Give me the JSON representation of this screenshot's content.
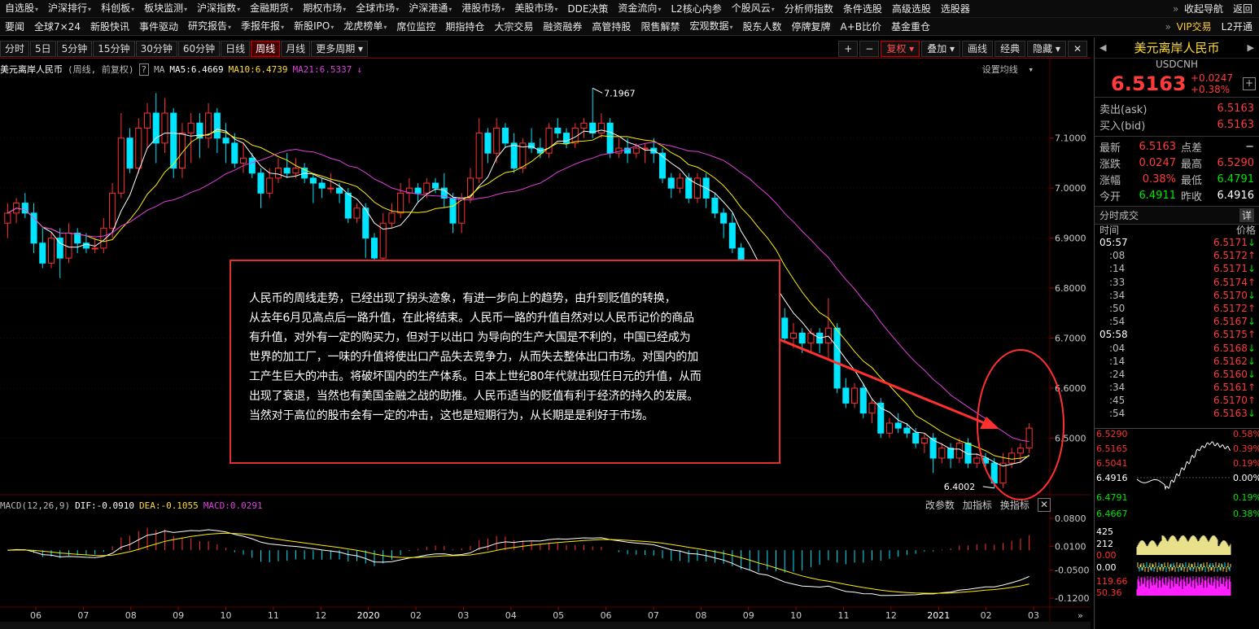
{
  "nav1": [
    "自选股",
    "沪深排行",
    "科创板",
    "板块监测",
    "沪深指数",
    "金融期货",
    "期权市场",
    "全球市场",
    "沪深港通",
    "港股市场",
    "美股市场",
    "DDE决策",
    "资金流向",
    "L2核心内参",
    "个股风云",
    "分析师指数",
    "条件选股",
    "高级选股",
    "选股器"
  ],
  "nav1_caret": [
    "▾",
    "▾",
    "▾",
    "▾",
    "▾",
    "▾",
    "▾",
    "▾",
    "▾",
    "▾",
    "▾",
    "",
    "▾",
    "",
    "▾",
    "",
    "",
    "",
    ""
  ],
  "nav1_right": [
    "收起导航",
    "返回"
  ],
  "nav2": [
    "要闻",
    "全球7×24",
    "新股快讯",
    "事件驱动",
    "研究报告",
    "季报年报",
    "新股IPO",
    "龙虎榜单",
    "席位监控",
    "期指持仓",
    "大宗交易",
    "融资融券",
    "高管持股",
    "限售解禁",
    "宏观数据",
    "股东人数",
    "停牌复牌",
    "A+B比价",
    "基金重仓"
  ],
  "nav2_caret": [
    "",
    "",
    "",
    "",
    "▾",
    "▾",
    "▾",
    "▾",
    "",
    "",
    "",
    "",
    "",
    "",
    "▾",
    "",
    "",
    "",
    ""
  ],
  "nav2_right": [
    "VIP交易",
    "L2开通"
  ],
  "periods": [
    "分时",
    "5日",
    "5分钟",
    "15分钟",
    "30分钟",
    "60分钟",
    "日线",
    "周线",
    "月线",
    "更多周期"
  ],
  "active_period": "周线",
  "toolbar_right": [
    "+",
    "−",
    "复权",
    "叠加",
    "画线",
    "经典",
    "隐藏"
  ],
  "legend": {
    "title": "美元离岸人民币",
    "mode": "(周线, 前复权)",
    "ma": "MA",
    "ma5": "MA5:6.4669",
    "ma10": "MA10:6.4739",
    "ma21": "MA21:6.5337",
    "settings": "设置均线"
  },
  "annotation": "人民币的周线走势，已经出现了拐头迹象，有进一步向上的趋势，由升到贬值的转换， 从去年6月见高点后一路升值，在此将结束。人民币一路的升值自然对以人民币记价的商品 有升值，对外有一定的购买力，但对于以出口 为导向的生产大国是不利的，中国已经成为世界的加工厂，一味的升值将使出口产品失去竞争力，从而失去整体出口市场。对国内的加工产生巨大的冲击。将破坏国内的生产体系。日本上世纪80年代就出现任日元的升值，从而出现了衰退，当然也有美国金融之战的助推。人民币适当的贬值有利于经济的持久的发展。当然对于高位的股市会有一定的冲击，这也是短期行为，从长期是是利好于市场。",
  "annotation_lines": [
    "人民币的周线走势，已经出现了拐头迹象，有进一步向上的趋势，由升到贬值的转换，",
    " 从去年6月见高点后一路升值，在此将结束。人民币一路的升值自然对以人民币记价的商品",
    " 有升值，对外有一定的购买力，但对于以出口 为导向的生产大国是不利的，中国已经成为",
    "世界的加工厂，一味的升值将使出口产品失去竞争力，从而失去整体出口市场。对国内的加",
    "工产生巨大的冲击。将破坏国内的生产体系。日本上世纪80年代就出现任日元的升值，从而",
    "出现了衰退，当然也有美国金融之战的助推。人民币适当的贬值有利于经济的持久的发展。",
    "当然对于高位的股市会有一定的冲击，这也是短期行为，从长期是是利好于市场。"
  ],
  "macd": {
    "name": "MACD(12,26,9)",
    "dif": "DIF:-0.0910",
    "dea": "DEA:-0.1055",
    "macd": "MACD:0.0291",
    "controls": [
      "改参数",
      "加指标",
      "换指标"
    ]
  },
  "side": {
    "name": "美元离岸人民币",
    "code": "USDCNH",
    "price": "6.5163",
    "chg": "+0.0247",
    "pct": "+0.38%",
    "ask_label": "卖出(ask)",
    "ask": "6.5163",
    "bid_label": "买入(bid)",
    "bid": "6.5163",
    "stats": [
      {
        "l1": "最新",
        "v1": "6.5163",
        "l2": "点差",
        "v2": "−"
      },
      {
        "l1": "涨跌",
        "v1": "0.0247",
        "l2": "最高",
        "v2": "6.5290"
      },
      {
        "l1": "涨幅",
        "v1": "0.38%",
        "l2": "最低",
        "v2": "6.4791"
      },
      {
        "l1": "今开",
        "v1": "6.4911",
        "l2": "昨收",
        "v2": "6.4916"
      }
    ],
    "ticks_title": "分时成交",
    "ticks_btn": "详",
    "ticks_h_time": "时间",
    "ticks_h_price": "价格",
    "ticks": [
      {
        "t": "05:57",
        "p": "6.5171",
        "d": "down"
      },
      {
        "t": ":08",
        "p": "6.5172",
        "d": "up"
      },
      {
        "t": ":14",
        "p": "6.5171",
        "d": "down"
      },
      {
        "t": ":33",
        "p": "6.5174",
        "d": "up"
      },
      {
        "t": ":34",
        "p": "6.5170",
        "d": "down"
      },
      {
        "t": ":50",
        "p": "6.5172",
        "d": "up"
      },
      {
        "t": ":54",
        "p": "6.5167",
        "d": "down"
      },
      {
        "t": "05:58",
        "p": "6.5175",
        "d": "up"
      },
      {
        "t": ":04",
        "p": "6.5168",
        "d": "down"
      },
      {
        "t": ":14",
        "p": "6.5162",
        "d": "down"
      },
      {
        "t": ":24",
        "p": "6.5160",
        "d": "down"
      },
      {
        "t": ":34",
        "p": "6.5161",
        "d": "up"
      },
      {
        "t": ":45",
        "p": "6.5170",
        "d": "up"
      },
      {
        "t": ":54",
        "p": "6.5163",
        "d": "down"
      }
    ],
    "mini_left": [
      "6.5290",
      "6.5165",
      "6.5041",
      "6.4916",
      "6.4791",
      "6.4667",
      "425",
      "212",
      "0.00",
      "0.00",
      "119.66",
      "50.36"
    ],
    "mini_right": [
      "0.58%",
      "0.39%",
      "0.19%",
      "0.00%",
      "0.19%",
      "0.38%"
    ]
  },
  "chart_data": {
    "type": "candlestick",
    "price_axis": [
      "7.1000",
      "7.0000",
      "6.9000",
      "6.8000",
      "6.7000",
      "6.6000",
      "6.5000"
    ],
    "time_axis": [
      "06",
      "07",
      "08",
      "09",
      "10",
      "11",
      "12",
      "2020",
      "02",
      "03",
      "04",
      "05",
      "06",
      "07",
      "08",
      "09",
      "10",
      "11",
      "12",
      "2021",
      "02",
      "03"
    ],
    "high_label": "7.1967",
    "low_label": "6.4002",
    "macd_axis": [
      "0.0800",
      "0.0100",
      "-0.0500",
      "-0.1200"
    ],
    "candles": [
      [
        6.93,
        6.95,
        6.9,
        6.97
      ],
      [
        6.95,
        6.97,
        6.93,
        6.98
      ],
      [
        6.97,
        6.95,
        6.94,
        6.99
      ],
      [
        6.95,
        6.89,
        6.87,
        6.97
      ],
      [
        6.89,
        6.85,
        6.84,
        6.92
      ],
      [
        6.85,
        6.9,
        6.84,
        6.91
      ],
      [
        6.9,
        6.86,
        6.82,
        6.92
      ],
      [
        6.86,
        6.91,
        6.85,
        6.93
      ],
      [
        6.91,
        6.89,
        6.87,
        6.92
      ],
      [
        6.89,
        6.88,
        6.87,
        6.91
      ],
      [
        6.88,
        6.88,
        6.87,
        6.9
      ],
      [
        6.88,
        6.92,
        6.87,
        6.94
      ],
      [
        6.92,
        6.99,
        6.9,
        7.01
      ],
      [
        6.99,
        7.1,
        6.98,
        7.15
      ],
      [
        7.1,
        7.04,
        7.03,
        7.12
      ],
      [
        7.04,
        7.12,
        7.03,
        7.14
      ],
      [
        7.12,
        7.15,
        7.08,
        7.17
      ],
      [
        7.15,
        7.09,
        7.05,
        7.19
      ],
      [
        7.09,
        7.15,
        7.07,
        7.18
      ],
      [
        7.15,
        7.04,
        7.02,
        7.16
      ],
      [
        7.04,
        7.11,
        7.02,
        7.13
      ],
      [
        7.11,
        7.13,
        7.05,
        7.15
      ],
      [
        7.13,
        7.1,
        7.06,
        7.15
      ],
      [
        7.1,
        7.15,
        7.08,
        7.17
      ],
      [
        7.15,
        7.1,
        7.07,
        7.16
      ],
      [
        7.1,
        7.09,
        7.05,
        7.13
      ],
      [
        7.09,
        7.05,
        7.04,
        7.11
      ],
      [
        7.05,
        7.06,
        7.03,
        7.09
      ],
      [
        7.06,
        7.03,
        7.02,
        7.07
      ],
      [
        7.03,
        6.99,
        6.96,
        7.04
      ],
      [
        6.99,
        7.02,
        6.98,
        7.04
      ],
      [
        7.02,
        7.04,
        7.01,
        7.06
      ],
      [
        7.04,
        7.03,
        7.02,
        7.07
      ],
      [
        7.03,
        7.04,
        7.02,
        7.06
      ],
      [
        7.04,
        7.02,
        7.01,
        7.05
      ],
      [
        7.02,
        7.01,
        6.97,
        7.03
      ],
      [
        7.01,
        7.0,
        6.98,
        7.02
      ],
      [
        7.0,
        7.0,
        6.99,
        7.03
      ],
      [
        7.0,
        6.99,
        6.97,
        7.01
      ],
      [
        6.99,
        6.94,
        6.93,
        7.0
      ],
      [
        6.94,
        6.96,
        6.93,
        6.97
      ],
      [
        6.96,
        6.9,
        6.86,
        6.97
      ],
      [
        6.9,
        6.86,
        6.84,
        6.91
      ],
      [
        6.86,
        6.93,
        6.85,
        6.95
      ],
      [
        6.93,
        6.95,
        6.92,
        6.97
      ],
      [
        6.95,
        6.99,
        6.94,
        7.01
      ],
      [
        6.99,
        7.0,
        6.97,
        7.02
      ],
      [
        7.0,
        6.99,
        6.97,
        7.01
      ],
      [
        6.99,
        7.01,
        6.98,
        7.02
      ],
      [
        7.01,
        7.0,
        6.99,
        7.02
      ],
      [
        7.0,
        6.98,
        6.96,
        7.03
      ],
      [
        6.98,
        6.93,
        6.91,
        6.99
      ],
      [
        6.93,
        6.98,
        6.91,
        6.99
      ],
      [
        6.98,
        7.02,
        6.97,
        7.04
      ],
      [
        7.02,
        7.11,
        7.01,
        7.14
      ],
      [
        7.11,
        7.07,
        7.05,
        7.12
      ],
      [
        7.07,
        7.12,
        7.05,
        7.14
      ],
      [
        7.12,
        7.09,
        7.08,
        7.13
      ],
      [
        7.09,
        7.04,
        7.03,
        7.11
      ],
      [
        7.04,
        7.09,
        7.03,
        7.1
      ],
      [
        7.09,
        7.08,
        7.07,
        7.12
      ],
      [
        7.08,
        7.07,
        7.06,
        7.1
      ],
      [
        7.07,
        7.12,
        7.06,
        7.13
      ],
      [
        7.12,
        7.11,
        7.1,
        7.14
      ],
      [
        7.11,
        7.09,
        7.08,
        7.12
      ],
      [
        7.09,
        7.12,
        7.08,
        7.13
      ],
      [
        7.12,
        7.13,
        7.1,
        7.14
      ],
      [
        7.13,
        7.11,
        7.1,
        7.2
      ],
      [
        7.11,
        7.13,
        7.1,
        7.15
      ],
      [
        7.13,
        7.07,
        7.06,
        7.14
      ],
      [
        7.07,
        7.08,
        7.06,
        7.1
      ],
      [
        7.08,
        7.07,
        7.05,
        7.1
      ],
      [
        7.07,
        7.08,
        7.06,
        7.09
      ],
      [
        7.08,
        7.08,
        7.05,
        7.09
      ],
      [
        7.08,
        7.07,
        7.05,
        7.1
      ],
      [
        7.07,
        7.02,
        7.01,
        7.08
      ],
      [
        7.02,
        7.0,
        6.98,
        7.03
      ],
      [
        7.0,
        7.02,
        6.99,
        7.03
      ],
      [
        7.02,
        6.98,
        6.97,
        7.03
      ],
      [
        6.98,
        7.02,
        6.97,
        7.03
      ],
      [
        7.02,
        6.98,
        6.96,
        7.03
      ],
      [
        6.98,
        6.95,
        6.94,
        6.99
      ],
      [
        6.95,
        6.93,
        6.9,
        6.96
      ],
      [
        6.93,
        6.88,
        6.87,
        6.95
      ],
      [
        6.88,
        6.83,
        6.81,
        6.89
      ],
      [
        6.83,
        6.84,
        6.82,
        6.85
      ],
      [
        6.84,
        6.78,
        6.76,
        6.85
      ],
      [
        6.78,
        6.82,
        6.77,
        6.84
      ],
      [
        6.82,
        6.74,
        6.72,
        6.83
      ],
      [
        6.74,
        6.7,
        6.69,
        6.76
      ],
      [
        6.7,
        6.71,
        6.68,
        6.73
      ],
      [
        6.71,
        6.69,
        6.67,
        6.72
      ],
      [
        6.69,
        6.71,
        6.67,
        6.72
      ],
      [
        6.71,
        6.69,
        6.67,
        6.72
      ],
      [
        6.69,
        6.72,
        6.66,
        6.78
      ],
      [
        6.72,
        6.6,
        6.59,
        6.73
      ],
      [
        6.6,
        6.57,
        6.56,
        6.62
      ],
      [
        6.57,
        6.6,
        6.56,
        6.61
      ],
      [
        6.6,
        6.55,
        6.54,
        6.61
      ],
      [
        6.55,
        6.57,
        6.53,
        6.58
      ],
      [
        6.57,
        6.51,
        6.5,
        6.58
      ],
      [
        6.51,
        6.53,
        6.5,
        6.54
      ],
      [
        6.53,
        6.52,
        6.51,
        6.55
      ],
      [
        6.52,
        6.51,
        6.5,
        6.53
      ],
      [
        6.51,
        6.49,
        6.48,
        6.52
      ],
      [
        6.49,
        6.5,
        6.47,
        6.51
      ],
      [
        6.5,
        6.46,
        6.43,
        6.51
      ],
      [
        6.46,
        6.48,
        6.45,
        6.49
      ],
      [
        6.48,
        6.46,
        6.44,
        6.49
      ],
      [
        6.46,
        6.49,
        6.45,
        6.5
      ],
      [
        6.49,
        6.45,
        6.44,
        6.5
      ],
      [
        6.45,
        6.46,
        6.44,
        6.47
      ],
      [
        6.46,
        6.45,
        6.44,
        6.47
      ],
      [
        6.45,
        6.41,
        6.4,
        6.46
      ],
      [
        6.41,
        6.45,
        6.4,
        6.47
      ],
      [
        6.45,
        6.47,
        6.44,
        6.48
      ],
      [
        6.47,
        6.48,
        6.45,
        6.49
      ],
      [
        6.48,
        6.52,
        6.47,
        6.53
      ]
    ]
  }
}
